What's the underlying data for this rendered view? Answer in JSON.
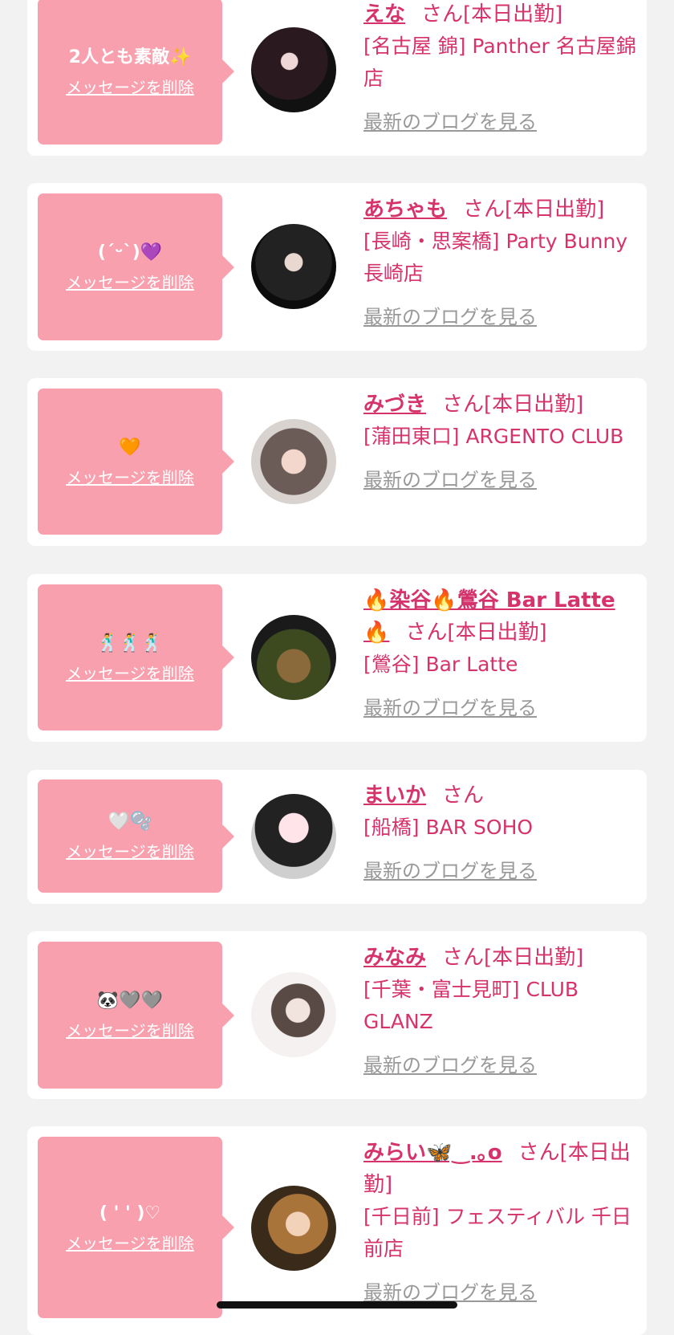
{
  "delete_label": "メッセージを削除",
  "blog_label": "最新のブログを見る",
  "colors": {
    "accent": "#d6336c",
    "bubble": "#f9a0ae",
    "link_gray": "#999999"
  },
  "cards": [
    {
      "message": "2人とも素敵✨",
      "name": "えな",
      "san": "さん[本日出勤]",
      "store": "[名古屋 錦] Panther 名古屋錦店"
    },
    {
      "message": "(ˊᵕˋ)💜",
      "name": "あちゃも",
      "san": "さん[本日出勤]",
      "store": "[長崎・思案橋] Party Bunny 長崎店"
    },
    {
      "message": "🧡",
      "name": "みづき",
      "san": "さん[本日出勤]",
      "store": "[蒲田東口] ARGENTO CLUB"
    },
    {
      "message": "🕺🕺🕺",
      "name": "🔥染谷🔥鶯谷 Bar Latte 🔥",
      "san": "さん[本日出勤]",
      "store": "[鶯谷] Bar Latte"
    },
    {
      "message": "🤍🫧",
      "name": "まいか",
      "san": "さん",
      "store": "[船橋] BAR SOHO"
    },
    {
      "message": "🐼🩶🩶",
      "name": "みなみ",
      "san": "さん[本日出勤]",
      "store": "[千葉・富士見町] CLUB GLANZ"
    },
    {
      "message": "( ' ' )♡",
      "name": "みらい🦋‿.｡o",
      "san": "さん[本日出勤]",
      "store": "[千日前] フェスティバル 千日前店"
    }
  ]
}
